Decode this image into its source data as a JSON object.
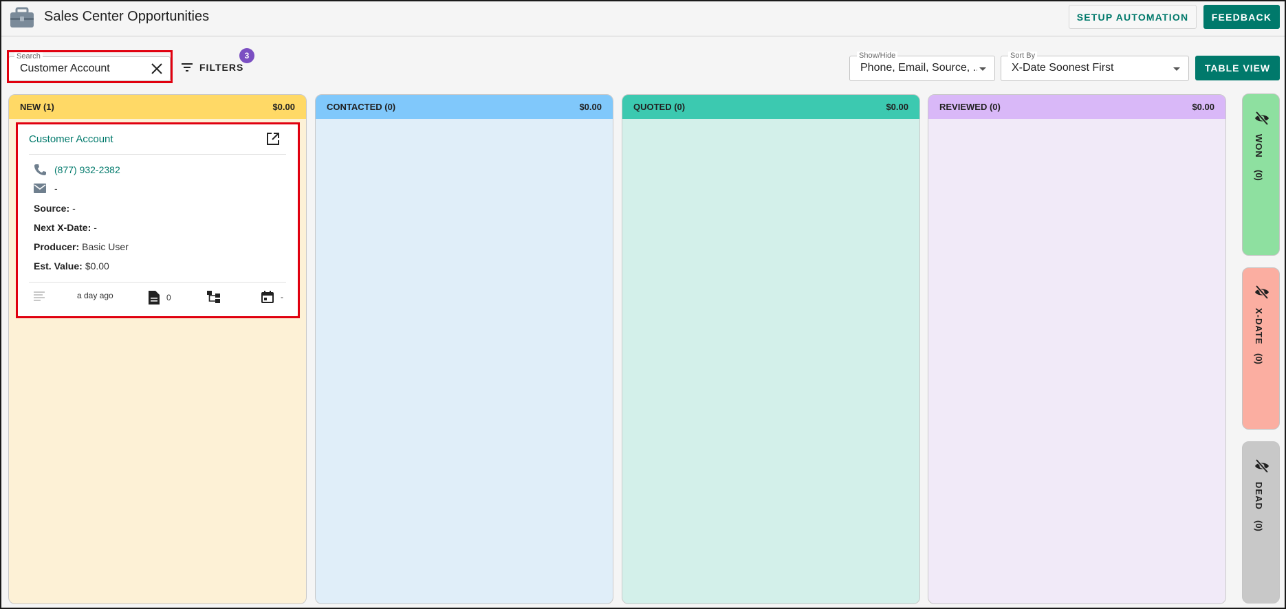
{
  "header": {
    "title": "Sales Center Opportunities",
    "setup_automation": "SETUP AUTOMATION",
    "feedback": "FEEDBACK"
  },
  "toolbar": {
    "search_label": "Search",
    "search_value": "Customer Account",
    "filters_label": "FILTERS",
    "filters_count": "3",
    "show_hide_label": "Show/Hide",
    "show_hide_value": "Phone, Email, Source, ...",
    "sort_by_label": "Sort By",
    "sort_by_value": "X-Date Soonest First",
    "table_view": "TABLE VIEW"
  },
  "columns": [
    {
      "title": "NEW (1)",
      "total": "$0.00",
      "head_color": "#ffd966",
      "body_color": "#fdf1d6"
    },
    {
      "title": "CONTACTED (0)",
      "total": "$0.00",
      "head_color": "#80c8fb",
      "body_color": "#e0eef9"
    },
    {
      "title": "QUOTED (0)",
      "total": "$0.00",
      "head_color": "#3cc9b0",
      "body_color": "#d3f0ea"
    },
    {
      "title": "REVIEWED (0)",
      "total": "$0.00",
      "head_color": "#d9b8f8",
      "body_color": "#f1eaf8"
    }
  ],
  "card": {
    "title": "Customer Account",
    "phone": "(877) 932-2382",
    "email": "-",
    "source_label": "Source:",
    "source_value": "-",
    "xdate_label": "Next X-Date:",
    "xdate_value": "-",
    "producer_label": "Producer:",
    "producer_value": "Basic User",
    "value_label": "Est. Value:",
    "value_value": "$0.00",
    "activity_time": "a day ago",
    "documents_count": "0",
    "calendar_value": "-"
  },
  "side_columns": [
    {
      "label": "WON",
      "count": "(0)",
      "color": "#8ee0a0"
    },
    {
      "label": "X-DATE",
      "count": "(0)",
      "color": "#fbaea1"
    },
    {
      "label": "DEAD",
      "count": "(0)",
      "color": "#c8c8c8"
    }
  ]
}
